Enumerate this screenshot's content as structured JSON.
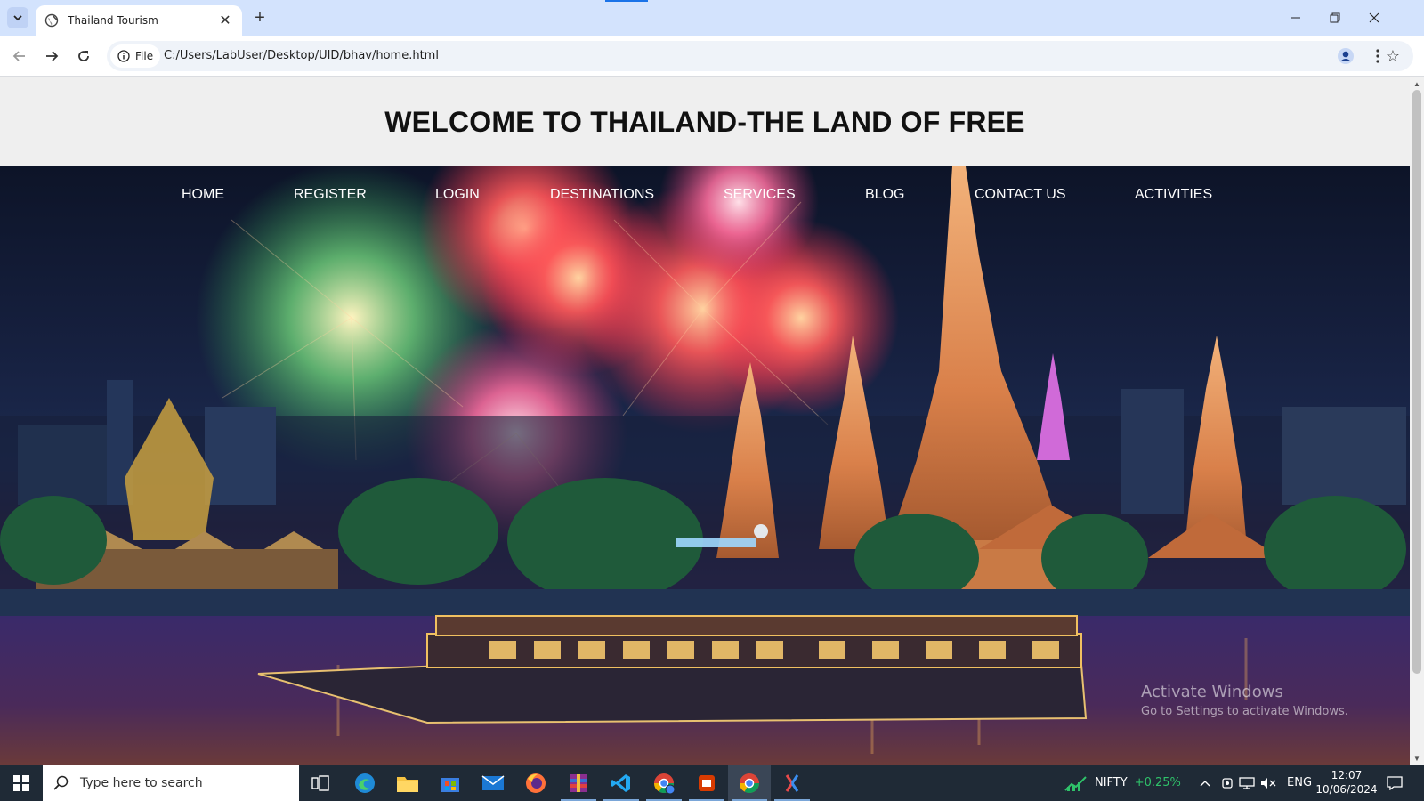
{
  "browser": {
    "tab": {
      "title": "Thailand Tourism",
      "favicon": "globe-icon"
    },
    "new_tab_label": "+",
    "address": {
      "scheme_label": "File",
      "url": "C:/Users/LabUser/Desktop/UID/bhav/home.html"
    },
    "window_controls": [
      "minimize-icon",
      "restore-icon",
      "close-icon"
    ]
  },
  "page": {
    "title": "WELCOME TO THAILAND-THE LAND OF FREE",
    "nav": [
      {
        "label": "HOME"
      },
      {
        "label": "REGISTER"
      },
      {
        "label": "LOGIN"
      },
      {
        "label": "DESTINATIONS"
      },
      {
        "label": "SERVICES"
      },
      {
        "label": "BLOG"
      },
      {
        "label": "CONTACT US"
      },
      {
        "label": "ACTIVITIES"
      }
    ],
    "hero_image": "bangkok-temple-fireworks-night"
  },
  "watermark": {
    "line1": "Activate Windows",
    "line2": "Go to Settings to activate Windows."
  },
  "taskbar": {
    "search_placeholder": "Type here to search",
    "apps": [
      "task-view",
      "edge",
      "file-explorer",
      "microsoft-store",
      "mail",
      "firefox",
      "winrar",
      "vscode",
      "chrome-profile",
      "office",
      "chrome",
      "app-pinned"
    ],
    "nifty": {
      "label": "NIFTY",
      "change": "+0.25%",
      "change_color": "#2fc26a"
    },
    "language": "ENG",
    "time": "12:07",
    "date": "10/06/2024"
  },
  "colors": {
    "tabstrip": "#d3e3fd",
    "taskbar": "#1f2a36",
    "page_header_bg": "#efefef",
    "nav_text": "#ffffff"
  }
}
